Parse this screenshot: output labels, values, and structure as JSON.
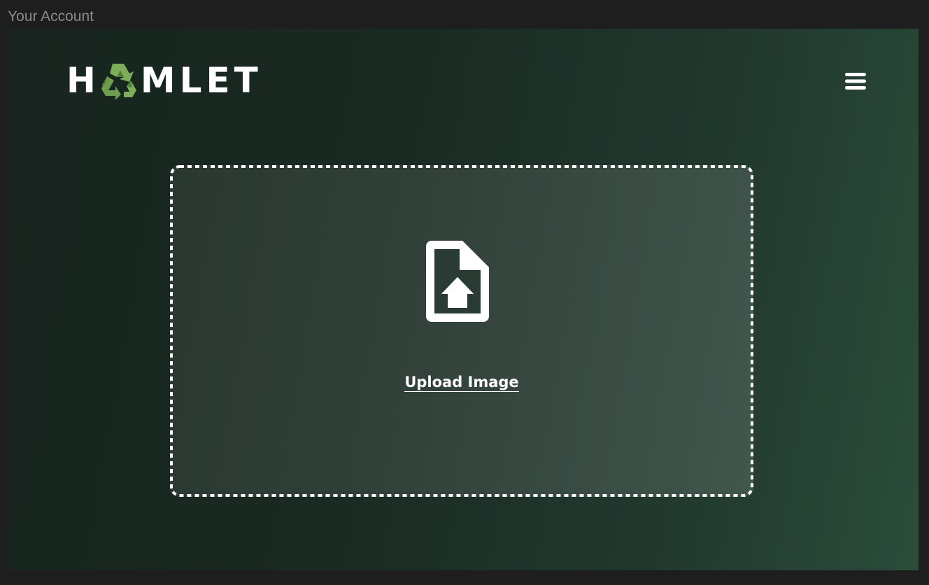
{
  "window": {
    "title": "Your Account"
  },
  "header": {
    "logo_left": "H",
    "logo_right": "MLET",
    "logo_icon": "recycle-icon",
    "menu_icon": "hamburger-menu-icon"
  },
  "upload": {
    "icon": "file-upload-icon",
    "label": "Upload Image"
  },
  "colors": {
    "window_bg": "#1e1e1e",
    "title_text": "#8b8b8b",
    "gradient_dark": "#18241f",
    "gradient_light": "#2a4d3a",
    "recycle_green_light": "#7fae5a",
    "recycle_green_dark": "#4f7f3a",
    "white": "#ffffff"
  }
}
